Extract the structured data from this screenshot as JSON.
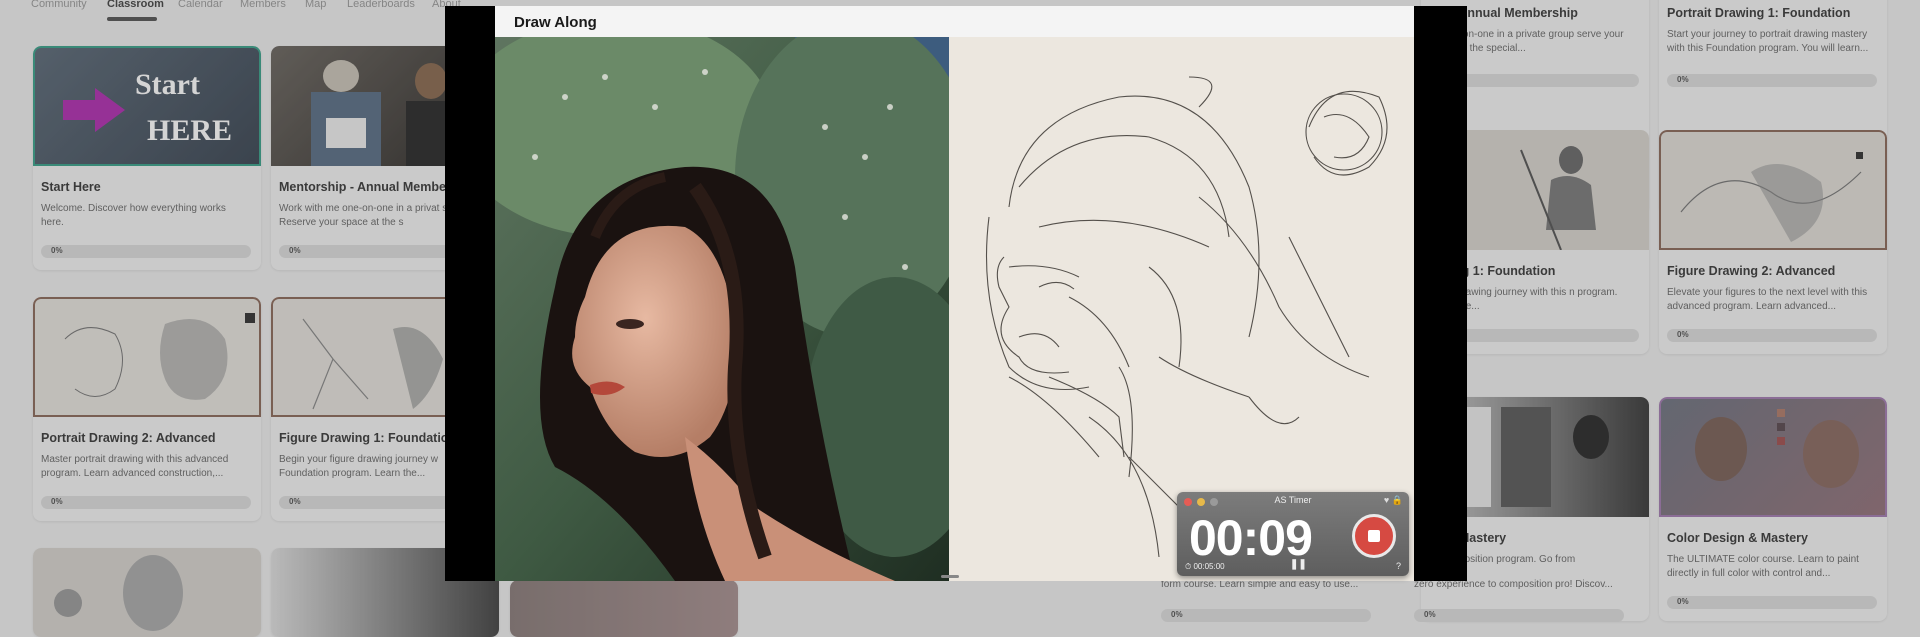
{
  "nav": {
    "tabs": [
      "Community",
      "Classroom",
      "Calendar",
      "Members",
      "Map",
      "Leaderboards",
      "About"
    ],
    "active": "Classroom"
  },
  "courses": [
    {
      "title": "Start Here",
      "desc": "Welcome. Discover how everything works here.",
      "progress": "0%",
      "thumb_text_1": "Start",
      "thumb_text_2": "HERE"
    },
    {
      "title": "Mentorship - Annual Membe",
      "desc": "Work with me one-on-one in a privat setting. Reserve your space at the s",
      "progress": "0%"
    },
    {
      "title": "Portrait Drawing 2: Advanced",
      "desc": "Master portrait drawing with this advanced program. Learn advanced construction,...",
      "progress": "0%"
    },
    {
      "title": "Figure Drawing 1: Foundatio",
      "desc": "Begin your figure drawing journey w Foundation program. Learn the...",
      "progress": "0%"
    },
    {
      "title": "hip - Annual Membership",
      "desc": "ne one-on-one in a private group serve your space at the special...",
      "progress": ""
    },
    {
      "title": "Portrait Drawing 1: Foundation",
      "desc": "Start your journey to portrait drawing mastery with this Foundation program. You will learn...",
      "progress": "0%"
    },
    {
      "title": "rawing 1: Foundation",
      "desc": "figure drawing journey with this n program. Learn the...",
      "progress": ""
    },
    {
      "title": "Figure Drawing 2: Advanced",
      "desc": "Elevate your figures to the next level with this advanced program. Learn advanced...",
      "progress": "0%"
    },
    {
      "title": "ition Mastery",
      "desc": "te composition program. Go from",
      "progress": ""
    },
    {
      "title": "Color Design & Mastery",
      "desc": "The ULTIMATE color course. Learn to paint directly in full color with control and...",
      "progress": "0%"
    },
    {
      "title": "",
      "desc": "form course. Learn simple and easy to use...",
      "progress": "0%"
    },
    {
      "title": "",
      "desc": "zero experience to composition pro! Discov...",
      "progress": "0%"
    }
  ],
  "modal": {
    "title": "Draw Along"
  },
  "timer": {
    "app_name": "AS Timer",
    "time": "00:09",
    "elapsed": "00:05:00",
    "pause_icon": "pause-icon",
    "help": "?",
    "stop_color": "#d64a42"
  },
  "colors": {
    "progress_track": "#dcdcdc",
    "start_arrow": "#b02fb0",
    "active_tab_underline": "#555555"
  }
}
